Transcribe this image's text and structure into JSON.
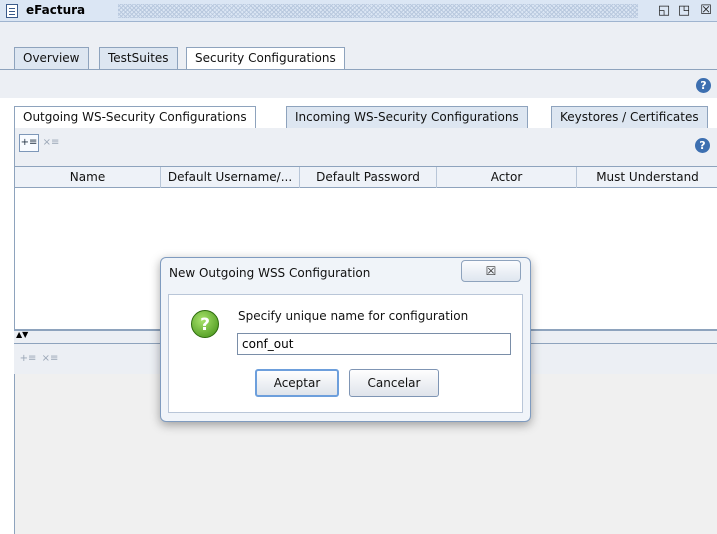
{
  "window": {
    "title": "eFactura"
  },
  "main_tabs": [
    {
      "label": "Overview"
    },
    {
      "label": "TestSuites"
    },
    {
      "label": "Security Configurations"
    }
  ],
  "sub_tabs": [
    {
      "label": "Outgoing WS-Security Configurations"
    },
    {
      "label": "Incoming WS-Security Configurations"
    },
    {
      "label": "Keystores / Certificates"
    }
  ],
  "table": {
    "columns": [
      "Name",
      "Default Username/...",
      "Default Password",
      "Actor",
      "Must Understand"
    ],
    "rows": []
  },
  "icons": {
    "add": "add-config-icon",
    "remove": "remove-config-icon",
    "help": "help-icon",
    "question": "question-icon"
  },
  "dialog": {
    "title": "New Outgoing WSS Configuration",
    "close_glyph": "☒",
    "prompt": "Specify unique name for configuration",
    "input_value": "conf_out",
    "ok_label": "Aceptar",
    "cancel_label": "Cancelar"
  },
  "colors": {
    "accent": "#3d6fb0",
    "ok_icon": "#3f8d14"
  }
}
